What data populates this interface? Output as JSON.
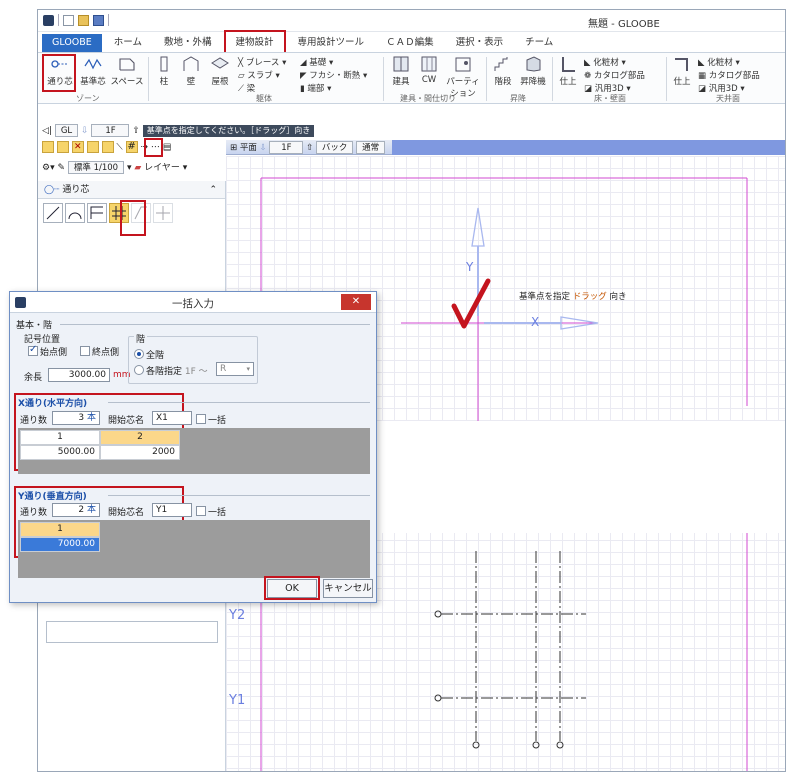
{
  "window": {
    "title": "無題 - GLOOBE"
  },
  "tabs": [
    "GLOOBE",
    "ホーム",
    "敷地・外構",
    "建物設計",
    "専用設計ツール",
    "ＣＡＤ編集",
    "選択・表示",
    "チーム"
  ],
  "ribbon": {
    "zone": {
      "items": [
        "通り芯",
        "基準芯",
        "スペース"
      ],
      "label": "ゾーン"
    },
    "body": {
      "big": [
        "柱",
        "壁",
        "屋根"
      ],
      "small": [
        "ブレース",
        "基礎",
        "スラブ",
        "フカシ・断熱",
        "梁",
        "端部"
      ],
      "label": "躯体"
    },
    "openings": {
      "items": [
        "建具",
        "CW",
        "パーティション"
      ],
      "label": "建具・間仕切り"
    },
    "stairs": {
      "items": [
        "階段",
        "昇降機"
      ],
      "label": "昇降"
    },
    "floorwall": {
      "big": "仕上",
      "small": [
        "化粧材",
        "カタログ部品",
        "汎用3D"
      ],
      "label": "床・壁面"
    },
    "ceiling": {
      "big": "仕上",
      "small": [
        "化粧材",
        "カタログ部品",
        "汎用3D"
      ],
      "label": "天井面"
    }
  },
  "toolbar": {
    "gl": "GL",
    "floor": "1F",
    "instruction": "基準点を指定してください。［ドラッグ］向き",
    "scale": "標準 1/100",
    "layer": "レイヤー"
  },
  "panel": {
    "title": "通り芯"
  },
  "viewbar": {
    "plan": "平面",
    "floor": "1F",
    "back": "バック",
    "mode": "通常"
  },
  "canvas": {
    "hint_main": "基準点を指定",
    "hint_drag": "ドラッグ",
    "hint_dir": "向き",
    "axis_x": "X",
    "axis_y": "Y",
    "row_labels": [
      "Y2",
      "Y1"
    ]
  },
  "dialog": {
    "title": "一括入力",
    "basic": {
      "label": "基本・階",
      "symbol_pos": "記号位置",
      "start": "始点側",
      "end": "終点側",
      "extra_len_label": "余長",
      "extra_len": "3000.00",
      "unit": "mm",
      "floor_label": "階",
      "all_floors": "全階",
      "each_floor": "各階指定",
      "from_floor": "1F",
      "to_sep": "～",
      "to_floor": "R"
    },
    "x_dir": {
      "label": "X通り(水平方向)",
      "count_label": "通り数",
      "count": "3",
      "count_unit": "本",
      "start_name_label": "開始芯名",
      "start_name": "X1",
      "bulk": "一括",
      "headers": [
        "1",
        "2"
      ],
      "values": [
        "5000.00",
        "2000"
      ]
    },
    "y_dir": {
      "label": "Y通り(垂直方向)",
      "count_label": "通り数",
      "count": "2",
      "count_unit": "本",
      "start_name_label": "開始芯名",
      "start_name": "Y1",
      "bulk": "一括",
      "headers": [
        "1"
      ],
      "values": [
        "7000.00"
      ]
    },
    "ok": "OK",
    "cancel": "キャンセル"
  },
  "colors": {
    "highlight": "#c4141e",
    "file_tab": "#2b6cc4",
    "axis_line": "#d14ad1",
    "arrow": "#a9b8ef",
    "check": "#c4141e"
  }
}
